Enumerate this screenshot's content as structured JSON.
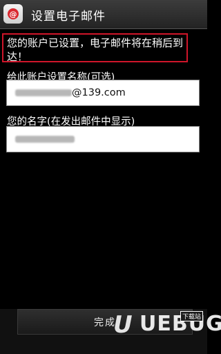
{
  "header": {
    "title": "设置电子邮件",
    "icon": "email-app-icon"
  },
  "notice": {
    "text": "您的账户已设置，电子邮件将在稍后到达！",
    "border_color": "#d0152a"
  },
  "account_name": {
    "label": "给此账户设置名称(可选)",
    "value_visible_suffix": "@139.com"
  },
  "your_name": {
    "label": "您的名字(在发出邮件中显示)"
  },
  "footer": {
    "done_label": "完成"
  },
  "watermark": {
    "brand": "UEBUG",
    "tag": "下载站"
  }
}
